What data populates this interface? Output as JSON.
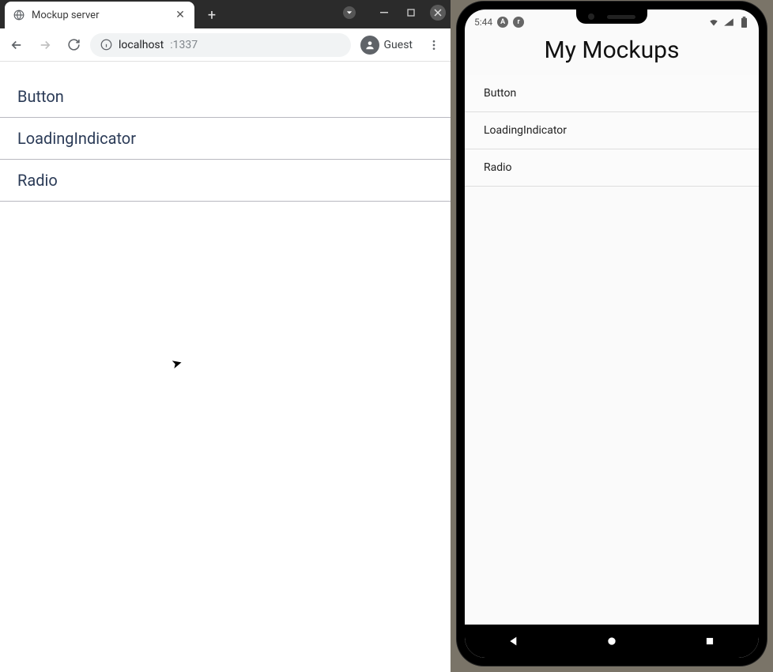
{
  "browser": {
    "tab_title": "Mockup server",
    "url_host": "localhost",
    "url_port": ":1337",
    "guest_label": "Guest",
    "page_items": [
      {
        "label": "Button"
      },
      {
        "label": "LoadingIndicator"
      },
      {
        "label": "Radio"
      }
    ]
  },
  "phone": {
    "status_time": "5:44",
    "app_title": "My Mockups",
    "app_items": [
      {
        "label": "Button"
      },
      {
        "label": "LoadingIndicator"
      },
      {
        "label": "Radio"
      }
    ]
  }
}
